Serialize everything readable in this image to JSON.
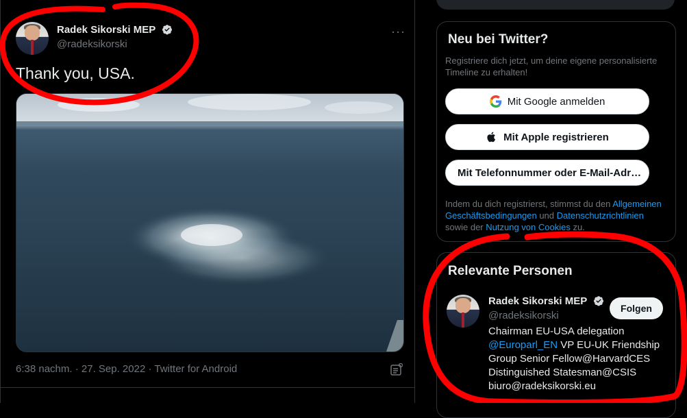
{
  "tweet": {
    "author_name": "Radek Sikorski MEP",
    "author_handle": "@radeksikorski",
    "text": "Thank you, USA.",
    "more_icon": "more-dots-icon",
    "timestamp": "6:38 nachm. · 27. Sep. 2022 · Twitter for Android"
  },
  "signup": {
    "title": "Neu bei Twitter?",
    "subtitle": "Registriere dich jetzt, um deine eigene personalisierte Timeline zu erhalten!",
    "google_label": "Mit Google anmelden",
    "apple_label": "Mit Apple registrieren",
    "phone_label": "Mit Telefonnummer oder E-Mail-Adr…",
    "terms_prefix": "Indem du dich registrierst, stimmst du den ",
    "terms_link1": "Allgemeinen Geschäftsbedingungen",
    "terms_mid": " und ",
    "terms_link2": "Datenschutzrichtlinien",
    "terms_mid2": " sowie der ",
    "terms_link3": "Nutzung von Cookies",
    "terms_suffix": " zu."
  },
  "relevant": {
    "title": "Relevante Personen",
    "person_name": "Radek Sikorski MEP",
    "person_handle": "@radeksikorski",
    "follow_label": "Folgen",
    "bio_line1": "Chairman EU-USA delegation",
    "bio_mention": "@Europarl_EN",
    "bio_line2_rest": " VP EU-UK Friendship",
    "bio_line3": "Group Senior Fellow@HarvardCES",
    "bio_line4": "Distinguished Statesman@CSIS",
    "bio_line5": "biuro@radeksikorski.eu"
  },
  "colors": {
    "background": "#000000",
    "accent": "#1d9bf0",
    "annotation": "#ff0000"
  }
}
